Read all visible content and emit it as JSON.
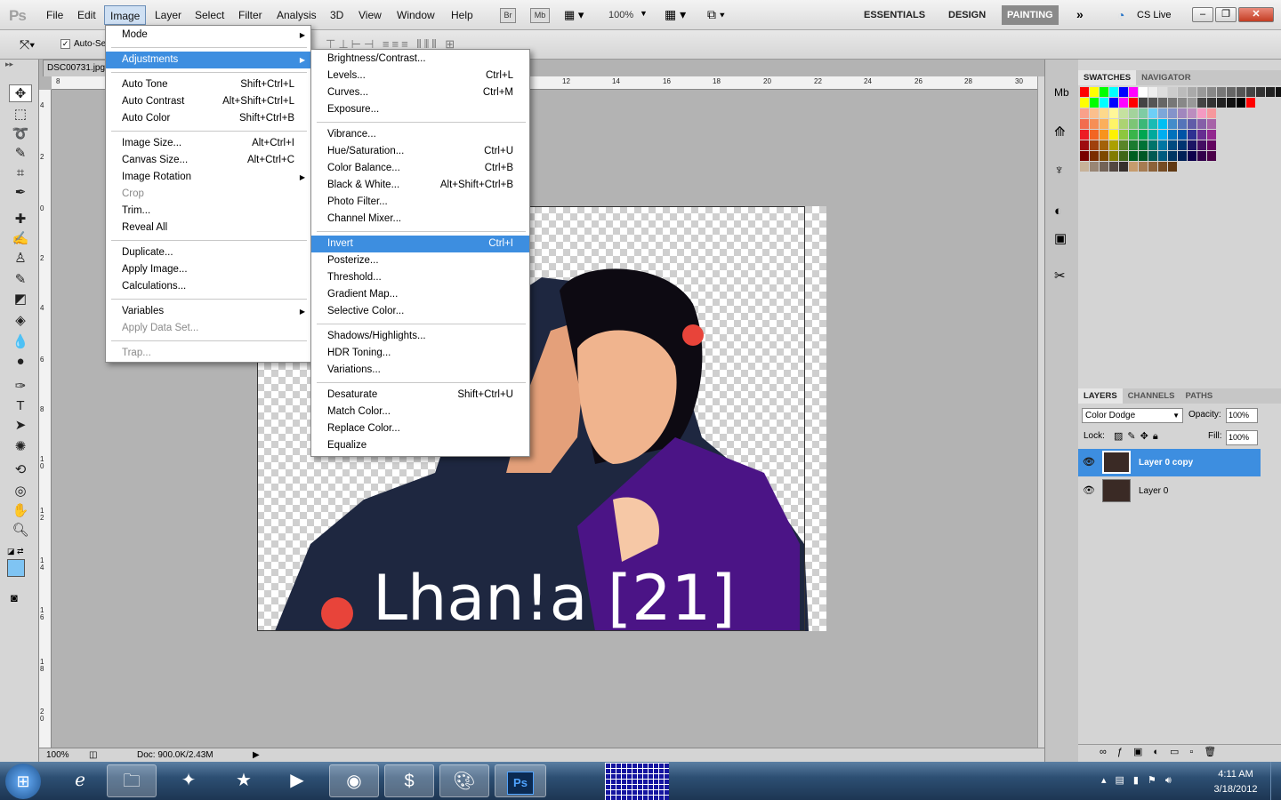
{
  "app": {
    "logo": "Ps"
  },
  "menubar": {
    "items": [
      "File",
      "Edit",
      "Image",
      "Layer",
      "Select",
      "Filter",
      "Analysis",
      "3D",
      "View",
      "Window",
      "Help"
    ],
    "active": "Image",
    "toolbar_buttons": {
      "bridge": "Br",
      "minibridge": "Mb"
    },
    "zoom": "100%",
    "workspaces": [
      "ESSENTIALS",
      "DESIGN",
      "PAINTING"
    ],
    "active_workspace": "PAINTING",
    "cs_live": "CS Live"
  },
  "options_bar": {
    "auto_select_label": "Auto-Se"
  },
  "document": {
    "tab_title": "DSC00731.jpg",
    "zoom": "100%",
    "doc_info": "Doc: 900.0K/2.43M",
    "canvas_text": "Lhan!a  [21]"
  },
  "image_menu": {
    "sections": [
      [
        {
          "label": "Mode",
          "submenu": true
        }
      ],
      [
        {
          "label": "Adjustments",
          "submenu": true,
          "highlight": true
        }
      ],
      [
        {
          "label": "Auto Tone",
          "shortcut": "Shift+Ctrl+L"
        },
        {
          "label": "Auto Contrast",
          "shortcut": "Alt+Shift+Ctrl+L"
        },
        {
          "label": "Auto Color",
          "shortcut": "Shift+Ctrl+B"
        }
      ],
      [
        {
          "label": "Image Size...",
          "shortcut": "Alt+Ctrl+I"
        },
        {
          "label": "Canvas Size...",
          "shortcut": "Alt+Ctrl+C"
        },
        {
          "label": "Image Rotation",
          "submenu": true
        },
        {
          "label": "Crop",
          "disabled": true
        },
        {
          "label": "Trim..."
        },
        {
          "label": "Reveal All"
        }
      ],
      [
        {
          "label": "Duplicate..."
        },
        {
          "label": "Apply Image..."
        },
        {
          "label": "Calculations..."
        }
      ],
      [
        {
          "label": "Variables",
          "submenu": true
        },
        {
          "label": "Apply Data Set...",
          "disabled": true
        }
      ],
      [
        {
          "label": "Trap...",
          "disabled": true
        }
      ]
    ]
  },
  "adjustments_menu": {
    "sections": [
      [
        {
          "label": "Brightness/Contrast..."
        },
        {
          "label": "Levels...",
          "shortcut": "Ctrl+L"
        },
        {
          "label": "Curves...",
          "shortcut": "Ctrl+M"
        },
        {
          "label": "Exposure..."
        }
      ],
      [
        {
          "label": "Vibrance..."
        },
        {
          "label": "Hue/Saturation...",
          "shortcut": "Ctrl+U"
        },
        {
          "label": "Color Balance...",
          "shortcut": "Ctrl+B"
        },
        {
          "label": "Black & White...",
          "shortcut": "Alt+Shift+Ctrl+B"
        },
        {
          "label": "Photo Filter..."
        },
        {
          "label": "Channel Mixer..."
        }
      ],
      [
        {
          "label": "Invert",
          "shortcut": "Ctrl+I",
          "highlight": true
        },
        {
          "label": "Posterize..."
        },
        {
          "label": "Threshold..."
        },
        {
          "label": "Gradient Map..."
        },
        {
          "label": "Selective Color..."
        }
      ],
      [
        {
          "label": "Shadows/Highlights..."
        },
        {
          "label": "HDR Toning..."
        },
        {
          "label": "Variations..."
        }
      ],
      [
        {
          "label": "Desaturate",
          "shortcut": "Shift+Ctrl+U"
        },
        {
          "label": "Match Color..."
        },
        {
          "label": "Replace Color..."
        },
        {
          "label": "Equalize"
        }
      ]
    ]
  },
  "rulers": {
    "h": [
      "8",
      "12",
      "14",
      "16",
      "18",
      "20",
      "22",
      "24",
      "26",
      "28",
      "30"
    ],
    "v": [
      "4",
      "2",
      "0",
      "2",
      "4",
      "6",
      "8",
      "1 0",
      "1 2",
      "1 4",
      "1 6",
      "1 8",
      "2 0"
    ]
  },
  "swatches_panel": {
    "tabs": [
      "SWATCHES",
      "NAVIGATOR"
    ]
  },
  "layers_panel": {
    "tabs": [
      "LAYERS",
      "CHANNELS",
      "PATHS"
    ],
    "blend_mode": "Color Dodge",
    "opacity_label": "Opacity:",
    "opacity": "100%",
    "lock_label": "Lock:",
    "fill_label": "Fill:",
    "fill": "100%",
    "layers": [
      {
        "name": "Layer 0 copy",
        "selected": true
      },
      {
        "name": "Layer 0",
        "selected": false
      }
    ]
  },
  "taskbar": {
    "time": "4:11 AM",
    "date": "3/18/2012"
  },
  "colors": {
    "accent": "#3d8ee0",
    "fg_swatch": "#7fc4f3"
  }
}
